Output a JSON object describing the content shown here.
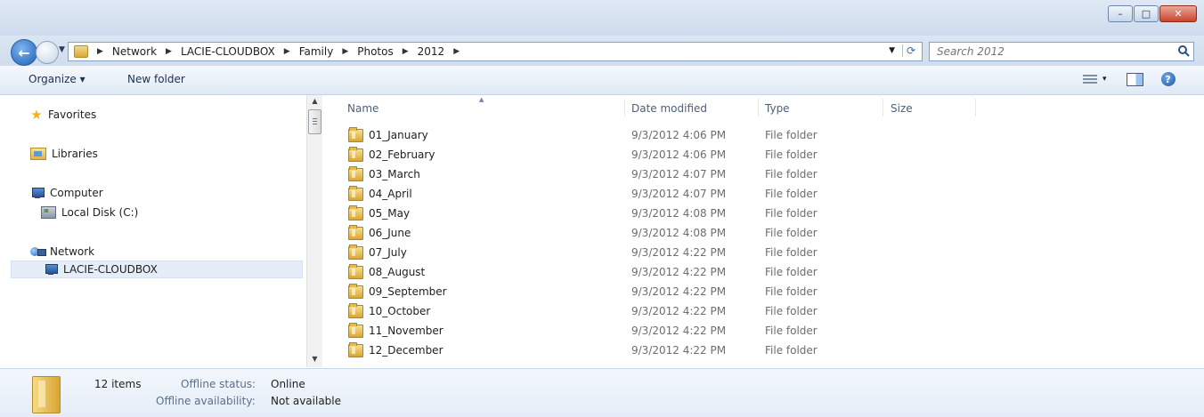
{
  "window": {
    "controls": {
      "minimize": "–",
      "maximize": "□",
      "close": "✕"
    }
  },
  "address": {
    "crumbs": [
      "Network",
      "LACIE-CLOUDBOX",
      "Family",
      "Photos",
      "2012"
    ],
    "icon": "folder-icon"
  },
  "search": {
    "placeholder": "Search 2012"
  },
  "toolbar": {
    "organize": "Organize ▾",
    "new_folder": "New folder",
    "view_menu_arrow": "▾",
    "help": "?"
  },
  "nav": {
    "favorites": "Favorites",
    "libraries": "Libraries",
    "computer": "Computer",
    "local_disk": "Local Disk (C:)",
    "network": "Network",
    "lacie": "LACIE-CLOUDBOX"
  },
  "columns": {
    "name": "Name",
    "date": "Date modified",
    "type": "Type",
    "size": "Size"
  },
  "files": [
    {
      "name": "01_January",
      "date": "9/3/2012 4:06 PM",
      "type": "File folder"
    },
    {
      "name": "02_February",
      "date": "9/3/2012 4:06 PM",
      "type": "File folder"
    },
    {
      "name": "03_March",
      "date": "9/3/2012 4:07 PM",
      "type": "File folder"
    },
    {
      "name": "04_April",
      "date": "9/3/2012 4:07 PM",
      "type": "File folder"
    },
    {
      "name": "05_May",
      "date": "9/3/2012 4:08 PM",
      "type": "File folder"
    },
    {
      "name": "06_June",
      "date": "9/3/2012 4:08 PM",
      "type": "File folder"
    },
    {
      "name": "07_July",
      "date": "9/3/2012 4:22 PM",
      "type": "File folder"
    },
    {
      "name": "08_August",
      "date": "9/3/2012 4:22 PM",
      "type": "File folder"
    },
    {
      "name": "09_September",
      "date": "9/3/2012 4:22 PM",
      "type": "File folder"
    },
    {
      "name": "10_October",
      "date": "9/3/2012 4:22 PM",
      "type": "File folder"
    },
    {
      "name": "11_November",
      "date": "9/3/2012 4:22 PM",
      "type": "File folder"
    },
    {
      "name": "12_December",
      "date": "9/3/2012 4:22 PM",
      "type": "File folder"
    }
  ],
  "details": {
    "count": "12 items",
    "offline_status_label": "Offline status:",
    "offline_status_value": "Online",
    "offline_avail_label": "Offline availability:",
    "offline_avail_value": "Not available"
  }
}
